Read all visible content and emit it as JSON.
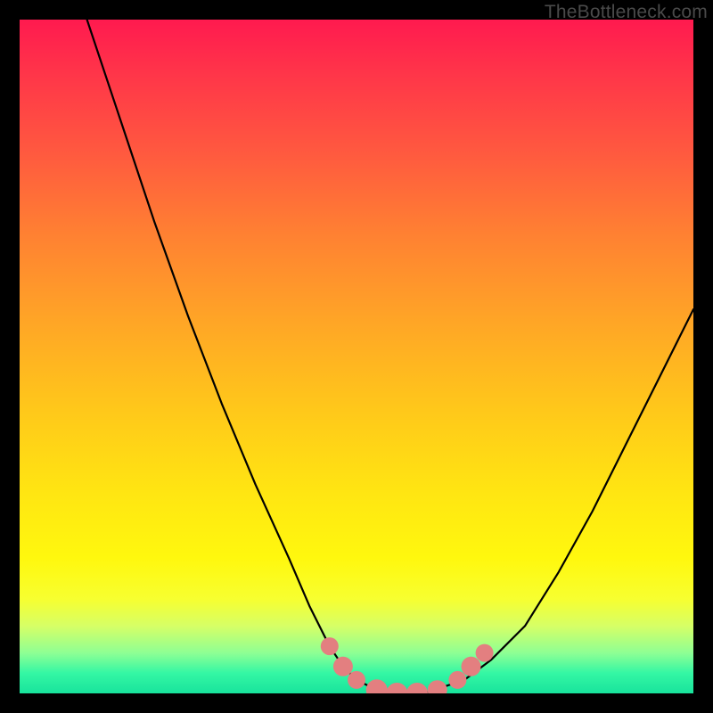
{
  "watermark": "TheBottleneck.com",
  "chart_data": {
    "type": "line",
    "title": "",
    "xlabel": "",
    "ylabel": "",
    "xlim": [
      0,
      100
    ],
    "ylim": [
      0,
      100
    ],
    "series": [
      {
        "name": "bottleneck-curve",
        "x": [
          10,
          15,
          20,
          25,
          30,
          35,
          40,
          43,
          46,
          48,
          50,
          52,
          55,
          58,
          60,
          63,
          66,
          70,
          75,
          80,
          85,
          90,
          95,
          100
        ],
        "y": [
          100,
          85,
          70,
          56,
          43,
          31,
          20,
          13,
          7,
          4,
          2,
          1,
          0,
          0,
          0,
          1,
          2,
          5,
          10,
          18,
          27,
          37,
          47,
          57
        ]
      }
    ],
    "markers": {
      "name": "highlight-dots",
      "color": "#e37f80",
      "points": [
        {
          "x": 46,
          "y": 7,
          "r": 2.0
        },
        {
          "x": 48,
          "y": 4,
          "r": 2.2
        },
        {
          "x": 50,
          "y": 2,
          "r": 2.0
        },
        {
          "x": 53,
          "y": 0.5,
          "r": 2.4
        },
        {
          "x": 56,
          "y": 0,
          "r": 2.4
        },
        {
          "x": 59,
          "y": 0,
          "r": 2.4
        },
        {
          "x": 62,
          "y": 0.5,
          "r": 2.2
        },
        {
          "x": 65,
          "y": 2,
          "r": 2.0
        },
        {
          "x": 67,
          "y": 4,
          "r": 2.2
        },
        {
          "x": 69,
          "y": 6,
          "r": 2.0
        }
      ]
    },
    "gradient_stops": [
      {
        "pos": 0,
        "color": "#ff1a4f"
      },
      {
        "pos": 50,
        "color": "#ffc81a"
      },
      {
        "pos": 80,
        "color": "#fff80e"
      },
      {
        "pos": 100,
        "color": "#18e39c"
      }
    ]
  }
}
